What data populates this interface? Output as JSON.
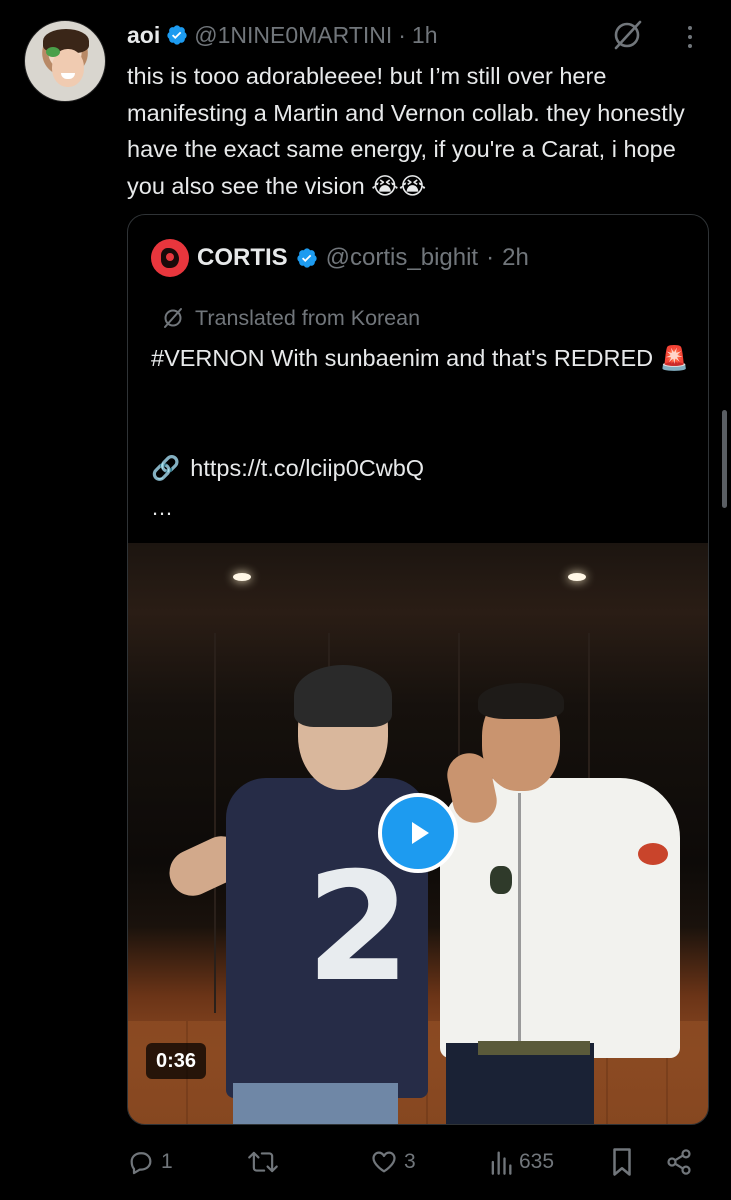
{
  "tweet": {
    "author_name": "aoi",
    "author_handle": "@1NINE0MARTINI",
    "separator": "·",
    "time": "1h",
    "text": "this is tooo adorableeee! but I’m still over here manifesting a Martin and Vernon collab. they honestly have the exact same energy, if you're a Carat, i hope you also see the vision 😭😭"
  },
  "quote": {
    "author_name": "CORTIS",
    "author_handle": "@cortis_bighit",
    "separator": "·",
    "time": "2h",
    "translated_label": "Translated from Korean",
    "text": "#VERNON With sunbaenim and that's REDRED 🚨",
    "link_emoji": "🔗",
    "link": "https://t.co/lciip0CwbQ",
    "ellipsis": "…",
    "video_duration": "0:36",
    "jersey_number": "2"
  },
  "actions": {
    "replies": "1",
    "reposts": "",
    "likes": "3",
    "views": "635"
  },
  "icons": {
    "verified": "verified-badge-icon",
    "grok": "grok-icon",
    "more": "more-icon",
    "translate": "translate-icon",
    "play": "play-icon",
    "reply": "reply-icon",
    "repost": "repost-icon",
    "like": "like-icon",
    "views": "views-icon",
    "bookmark": "bookmark-icon",
    "share": "share-icon"
  },
  "colors": {
    "background": "#000000",
    "text_primary": "#e7e9ea",
    "text_secondary": "#71767b",
    "verified_blue": "#1d9bf0",
    "border": "#2f3336"
  }
}
